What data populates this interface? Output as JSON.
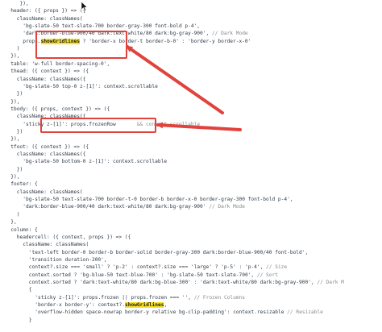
{
  "code_lines": [
    {
      "indent": 6,
      "segments": [
        {
          "t": "}),",
          "s": "plain"
        }
      ]
    },
    {
      "indent": 3,
      "segments": [
        {
          "t": "header: ({ props }) => ({",
          "s": "plain"
        }
      ]
    },
    {
      "indent": 5,
      "segments": [
        {
          "t": "className: classNames(",
          "s": "plain"
        }
      ]
    },
    {
      "indent": 7,
      "segments": [
        {
          "t": "'bg-slate-50 text-slate-700 border-gray-300 font-bold p-4',",
          "s": "plain"
        }
      ]
    },
    {
      "indent": 7,
      "segments": [
        {
          "t": "'dark:border-blue-900/40 dark:text-white/80 dark:bg-gray-900', ",
          "s": "plain"
        },
        {
          "t": "// Dark Mode",
          "s": "comment"
        }
      ]
    },
    {
      "indent": 7,
      "segments": [
        {
          "t": "props.",
          "s": "plain"
        },
        {
          "t": "showGridlines",
          "s": "hl"
        },
        {
          "t": " ? 'border-x border-t border-b-0' : 'border-y border-x-0'",
          "s": "plain"
        }
      ]
    },
    {
      "indent": 5,
      "segments": [
        {
          "t": ")",
          "s": "plain"
        }
      ]
    },
    {
      "indent": 3,
      "segments": [
        {
          "t": "}),",
          "s": "plain"
        }
      ]
    },
    {
      "indent": 3,
      "segments": [
        {
          "t": "table: 'w-full border-spacing-0',",
          "s": "plain"
        }
      ]
    },
    {
      "indent": 3,
      "segments": [
        {
          "t": "thead: ({ context }) => ({",
          "s": "plain"
        }
      ]
    },
    {
      "indent": 5,
      "segments": [
        {
          "t": "className: classNames({",
          "s": "plain"
        }
      ]
    },
    {
      "indent": 7,
      "segments": [
        {
          "t": "'bg-slate-50 top-0 z-[1]': context.scrollable",
          "s": "plain"
        }
      ]
    },
    {
      "indent": 5,
      "segments": [
        {
          "t": "})",
          "s": "plain"
        }
      ]
    },
    {
      "indent": 3,
      "segments": [
        {
          "t": "}),",
          "s": "plain"
        }
      ]
    },
    {
      "indent": 3,
      "segments": [
        {
          "t": "tbody: ({ props, context }) => ({",
          "s": "plain"
        }
      ]
    },
    {
      "indent": 5,
      "segments": [
        {
          "t": "className: classNames({",
          "s": "plain"
        }
      ]
    },
    {
      "indent": 7,
      "segments": [
        {
          "t": "'sticky z-[1]': props.frozenRow",
          "s": "plain"
        },
        {
          "t": "       && context.scrollable",
          "s": "comment"
        }
      ]
    },
    {
      "indent": 5,
      "segments": [
        {
          "t": "})",
          "s": "plain"
        }
      ]
    },
    {
      "indent": 3,
      "segments": [
        {
          "t": "}),",
          "s": "plain"
        }
      ]
    },
    {
      "indent": 3,
      "segments": [
        {
          "t": "tfoot: ({ context }) => ({",
          "s": "plain"
        }
      ]
    },
    {
      "indent": 5,
      "segments": [
        {
          "t": "className: classNames({",
          "s": "plain"
        }
      ]
    },
    {
      "indent": 7,
      "segments": [
        {
          "t": "'bg-slate-50 bottom-0 z-[1]': context.scrollable",
          "s": "plain"
        }
      ]
    },
    {
      "indent": 5,
      "segments": [
        {
          "t": "})",
          "s": "plain"
        }
      ]
    },
    {
      "indent": 3,
      "segments": [
        {
          "t": "}),",
          "s": "plain"
        }
      ]
    },
    {
      "indent": 3,
      "segments": [
        {
          "t": "footer: {",
          "s": "plain"
        }
      ]
    },
    {
      "indent": 5,
      "segments": [
        {
          "t": "className: classNames(",
          "s": "plain"
        }
      ]
    },
    {
      "indent": 7,
      "segments": [
        {
          "t": "'bg-slate-50 text-slate-700 border-t-0 border-b border-x-0 border-gray-300 font-bold p-4',",
          "s": "plain"
        }
      ]
    },
    {
      "indent": 7,
      "segments": [
        {
          "t": "'dark:border-blue-900/40 dark:text-white/80 dark:bg-gray-900' ",
          "s": "plain"
        },
        {
          "t": "// Dark Mode",
          "s": "comment"
        }
      ]
    },
    {
      "indent": 5,
      "segments": [
        {
          "t": ")",
          "s": "plain"
        }
      ]
    },
    {
      "indent": 3,
      "segments": [
        {
          "t": "},",
          "s": "plain"
        }
      ]
    },
    {
      "indent": 3,
      "segments": [
        {
          "t": "column: {",
          "s": "plain"
        }
      ]
    },
    {
      "indent": 5,
      "segments": [
        {
          "t": "headercell: ({ context, props }) => ({",
          "s": "plain"
        }
      ]
    },
    {
      "indent": 7,
      "segments": [
        {
          "t": "className: classNames(",
          "s": "plain"
        }
      ]
    },
    {
      "indent": 9,
      "segments": [
        {
          "t": "'text-left border-0 border-b border-solid border-gray-300 dark:border-blue-900/40 font-bold',",
          "s": "plain"
        }
      ]
    },
    {
      "indent": 9,
      "segments": [
        {
          "t": "'transition duration-200',",
          "s": "plain"
        }
      ]
    },
    {
      "indent": 9,
      "segments": [
        {
          "t": "context?.size === 'small' ? 'p-2' : context?.size === 'large' ? 'p-5' : 'p-4', ",
          "s": "plain"
        },
        {
          "t": "// Size",
          "s": "comment"
        }
      ]
    },
    {
      "indent": 9,
      "segments": [
        {
          "t": "context.sorted ? 'bg-blue-50 text-blue-700' : 'bg-slate-50 text-slate-700', ",
          "s": "plain"
        },
        {
          "t": "// Sort",
          "s": "comment"
        }
      ]
    },
    {
      "indent": 9,
      "segments": [
        {
          "t": "context.sorted ? 'dark:text-white/80 dark:bg-blue-300' : 'dark:text-white/80 dark:bg-gray-900', ",
          "s": "plain"
        },
        {
          "t": "// Dark M",
          "s": "comment"
        }
      ]
    },
    {
      "indent": 9,
      "segments": [
        {
          "t": "{",
          "s": "plain"
        }
      ]
    },
    {
      "indent": 11,
      "segments": [
        {
          "t": "'sticky z-[1]': props.frozen || props.frozen === '', ",
          "s": "plain"
        },
        {
          "t": "// Frozen Columns",
          "s": "comment"
        }
      ]
    },
    {
      "indent": 11,
      "segments": [
        {
          "t": "'border-x border-y': context?.",
          "s": "plain"
        },
        {
          "t": "showGridlines",
          "s": "hl"
        },
        {
          "t": ",",
          "s": "plain"
        }
      ]
    },
    {
      "indent": 11,
      "segments": [
        {
          "t": "'overflow-hidden space-nowrap border-y relative bg-clip-padding': context.resizable ",
          "s": "plain"
        },
        {
          "t": "// Resizable",
          "s": "comment"
        }
      ]
    },
    {
      "indent": 9,
      "segments": [
        {
          "t": "}",
          "s": "plain"
        }
      ]
    }
  ],
  "colors": {
    "annotation": "#e0433c",
    "highlight": "#f7e02a",
    "code": "#2f3b47",
    "comment": "#8a8a8a"
  }
}
